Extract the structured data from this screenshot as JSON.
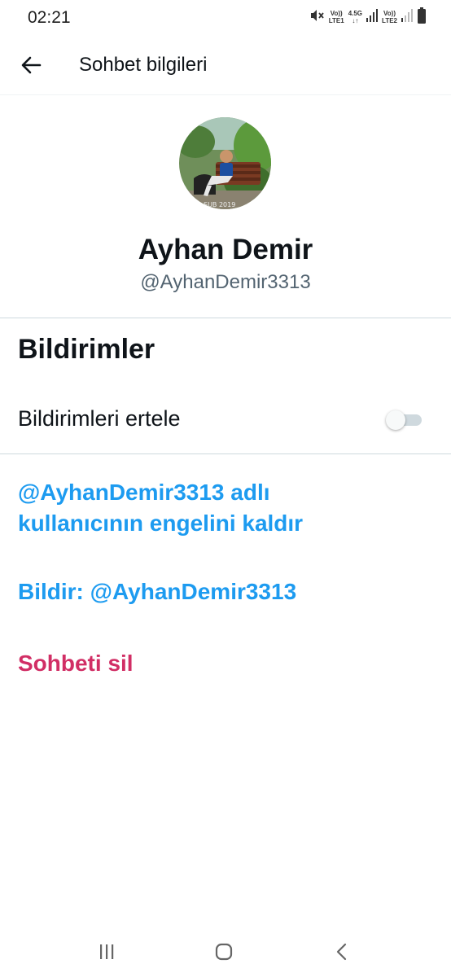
{
  "status_bar": {
    "time": "02:21",
    "sim1": {
      "top": "Vo))",
      "bottom": "LTE1"
    },
    "net_type": "4.5G",
    "sim2": {
      "top": "Vo))",
      "bottom": "LTE2"
    }
  },
  "app_bar": {
    "title": "Sohbet bilgileri"
  },
  "profile": {
    "name": "Ayhan Demir",
    "handle": "@AyhanDemir3313",
    "avatar_caption": "ŞUB 2019"
  },
  "notifications": {
    "section_title": "Bildirimler",
    "snooze_label": "Bildirimleri ertele",
    "snooze_enabled": false
  },
  "actions": {
    "unblock_line1": "@AyhanDemir3313 adlı",
    "unblock_line2": "kullanıcının engelini kaldır",
    "report": "Bildir: @AyhanDemir3313",
    "delete": "Sohbeti sil"
  },
  "icons": {
    "back": "arrow-left-icon",
    "mute": "mute-icon",
    "battery": "battery-icon",
    "recents": "recents-icon",
    "home": "home-icon",
    "nav_back": "chevron-left-icon"
  },
  "colors": {
    "link_blue": "#1d9bf0",
    "danger_red": "#d12e65",
    "primary_text": "#0f1419",
    "secondary_text": "#536471"
  }
}
